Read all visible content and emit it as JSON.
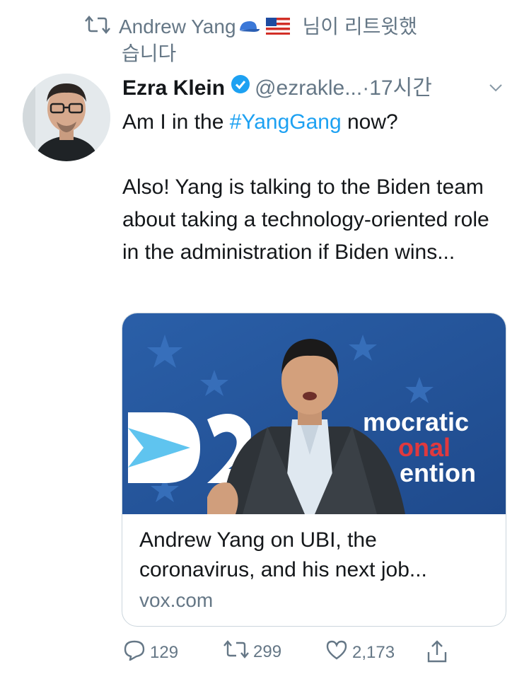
{
  "retweet": {
    "text": "Andrew Yang",
    "suffix": "님이 리트윗했",
    "suffix2": "습니다",
    "icons": [
      "retweet-icon",
      "cap-emoji",
      "us-flag-emoji"
    ]
  },
  "tweet": {
    "author_name": "Ezra Klein",
    "handle": "@ezrakle...",
    "separator": "·",
    "time": "17시간",
    "text_before_tag": "Am I in the ",
    "hashtag": "#YangGang",
    "text_after_tag": " now?",
    "body": "Also! Yang is talking to the Biden team about taking a technology-oriented role in the administration if Biden wins..."
  },
  "card": {
    "title": "Andrew Yang on UBI, the coronavirus, and his next job...",
    "domain": "vox.com",
    "image_text": [
      "mocratic",
      "onal",
      "ention"
    ]
  },
  "actions": {
    "replies": "129",
    "retweets": "299",
    "likes": "2,173"
  },
  "colors": {
    "accent": "#1da1f2",
    "muted": "#657786"
  }
}
